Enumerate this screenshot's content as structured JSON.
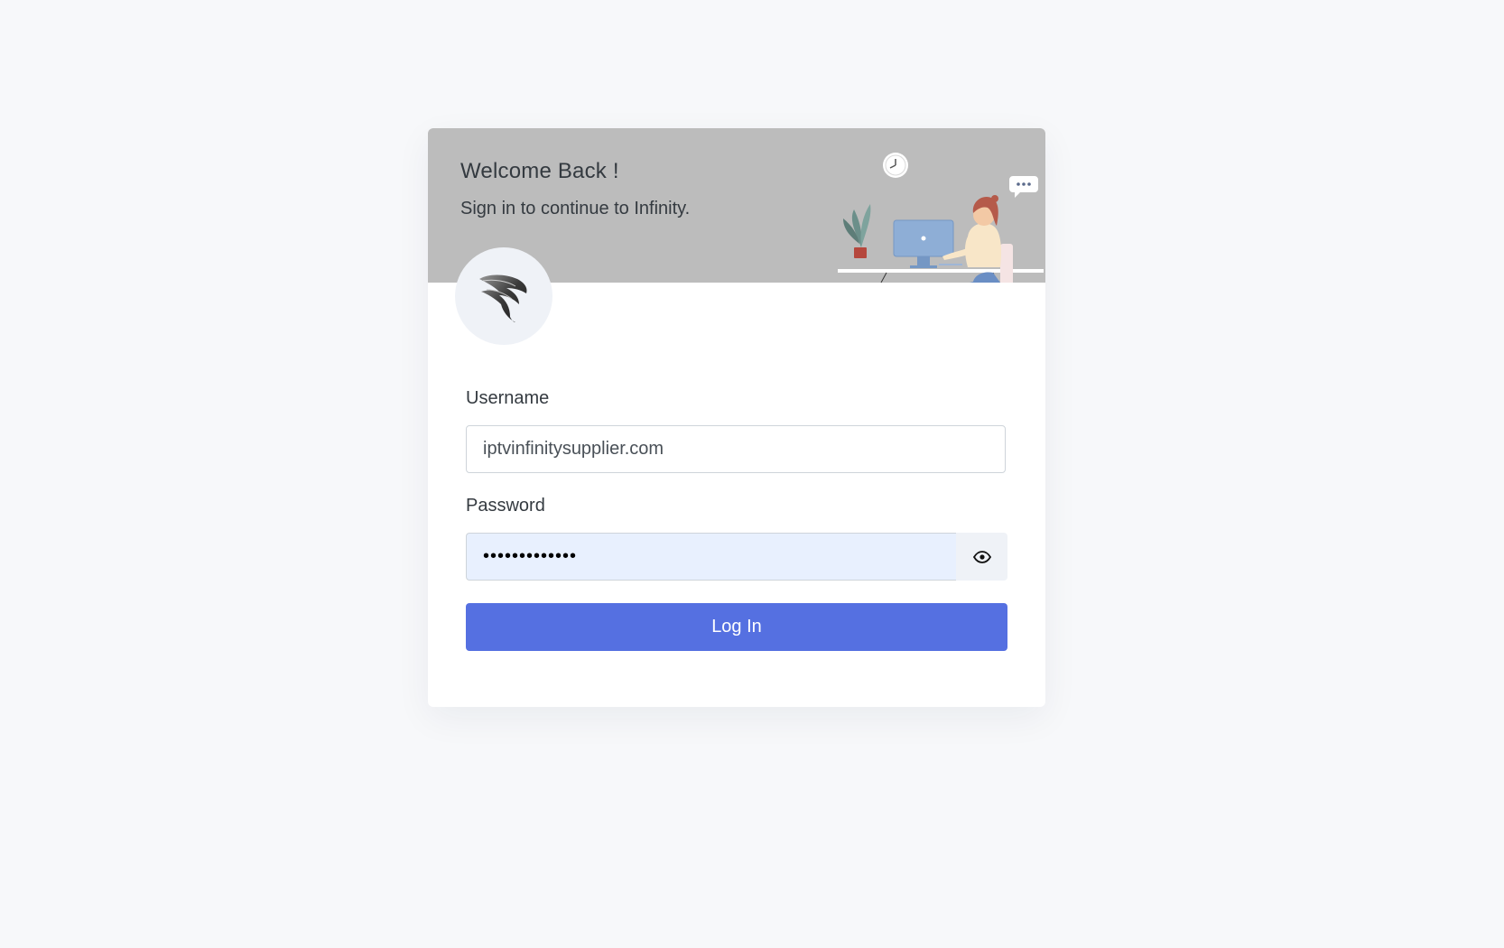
{
  "header": {
    "title": "Welcome Back !",
    "subtitle": "Sign in to continue to Infinity."
  },
  "form": {
    "username_label": "Username",
    "username_value": "iptvinfinitysupplier.com",
    "password_label": "Password",
    "password_value": "•••••••••••••",
    "login_label": "Log In"
  },
  "colors": {
    "page_bg": "#f7f8fa",
    "header_bg": "#bcbcbc",
    "primary": "#5570e1",
    "autofill_bg": "#e8f0fe"
  },
  "icons": {
    "logo": "feather-logo",
    "password_toggle": "eye-icon",
    "illustration": "office-illustration"
  }
}
